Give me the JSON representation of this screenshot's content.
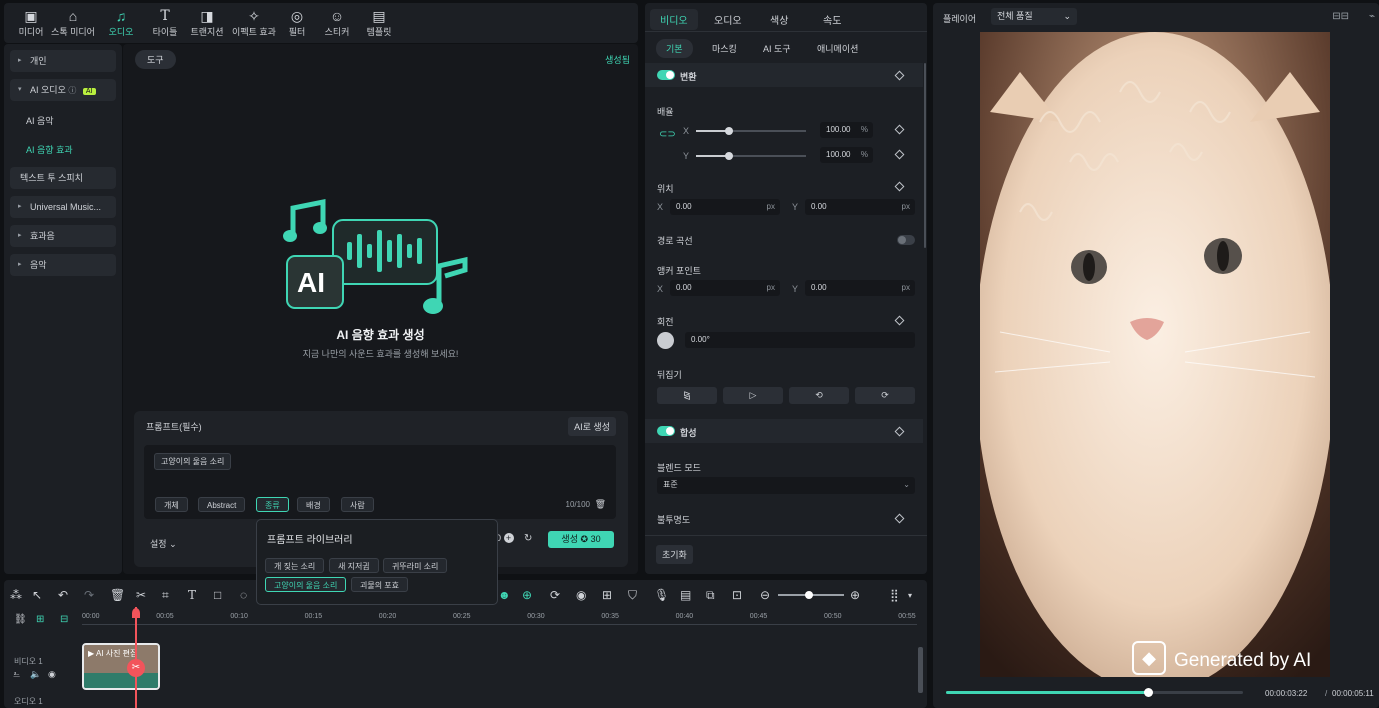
{
  "media_toolbar": {
    "items": [
      {
        "label": "미디어",
        "icon": "media-icon"
      },
      {
        "label": "스톡 미디어",
        "icon": "stock-media-icon"
      },
      {
        "label": "오디오",
        "icon": "music-note-icon"
      },
      {
        "label": "타이틀",
        "icon": "title-icon"
      },
      {
        "label": "트랜지션",
        "icon": "transition-icon"
      },
      {
        "label": "이펙트 효과",
        "icon": "effects-icon"
      },
      {
        "label": "필터",
        "icon": "filter-icon"
      },
      {
        "label": "스티커",
        "icon": "sticker-icon"
      },
      {
        "label": "템플릿",
        "icon": "template-icon"
      }
    ],
    "active": "오디오"
  },
  "sidebar": {
    "items": [
      {
        "label": "개인"
      },
      {
        "label": "AI 오디오",
        "badge": "AI"
      },
      {
        "label": "Universal Music..."
      },
      {
        "label": "효과음"
      },
      {
        "label": "음악"
      }
    ],
    "sub_items": [
      {
        "label": "AI 음악"
      },
      {
        "label": "AI 음향 효과"
      },
      {
        "label": "텍스트 투 스피치"
      }
    ]
  },
  "center": {
    "tools_pill": "도구",
    "generated_label": "생성됨",
    "hero_title": "AI 음향 효과 생성",
    "hero_subtitle": "지금 나만의 사운드 효과를 생성해 보세요!",
    "prompt_label": "프롬프트(필수)",
    "ai_generate_button": "AI로 생성",
    "prompt_tag": "고양이의 울음 소리",
    "chips": [
      "개체",
      "Abstract",
      "종류",
      "배경",
      "사람"
    ],
    "active_chip": "종류",
    "char_count": "10/100",
    "settings_label": "설정",
    "generate_button": "생성",
    "generate_cost": "30",
    "count_value": "0",
    "library": {
      "title": "프롬프트 라이브러리",
      "items": [
        "개 짖는 소리",
        "새 지저귐",
        "귀뚜라미 소리",
        "고양이의 울음 소리",
        "괴물의 포효"
      ],
      "active": "고양이의 울음 소리"
    }
  },
  "props": {
    "tabs": [
      "비디오",
      "오디오",
      "색상",
      "속도"
    ],
    "active_tab": "비디오",
    "subtabs": [
      "기본",
      "마스킹",
      "AI 도구",
      "애니메이션"
    ],
    "active_subtab": "기본",
    "transform_label": "변환",
    "scale_label": "배율",
    "scale_x": "100.00",
    "scale_y": "100.00",
    "scale_x_fraction": 0.3,
    "scale_y_fraction": 0.3,
    "percent_unit": "%",
    "position_label": "위치",
    "pos_x": "0.00",
    "pos_y": "0.00",
    "px_unit": "px",
    "path_curve_label": "경로 곡선",
    "anchor_label": "앵커 포인트",
    "anchor_x": "0.00",
    "anchor_y": "0.00",
    "rotate_label": "회전",
    "rotate_value": "0.00°",
    "flip_label": "뒤집기",
    "composite_label": "합성",
    "blend_mode_label": "블렌드 모드",
    "blend_mode_value": "표준",
    "opacity_label": "불투명도",
    "reset_button": "초기화",
    "x_label": "X",
    "y_label": "Y"
  },
  "player": {
    "label": "플레이어",
    "quality": "전체 품질",
    "watermark": "Generated by AI",
    "current_time": "00:00:03:22",
    "total_time": "00:00:05:11",
    "progress_fraction": 0.68
  },
  "timeline": {
    "ticks": [
      "00:00",
      "00:05",
      "00:10",
      "00:15",
      "00:20",
      "00:25",
      "00:30",
      "00:35",
      "00:40",
      "00:45",
      "00:50",
      "00:55"
    ],
    "video_track_label": "비디오 1",
    "audio_track_label": "오디오 1",
    "clip_label": "AI 사진 편집"
  },
  "colors": {
    "accent": "#3fd6b4",
    "playhead": "#f2545b"
  }
}
